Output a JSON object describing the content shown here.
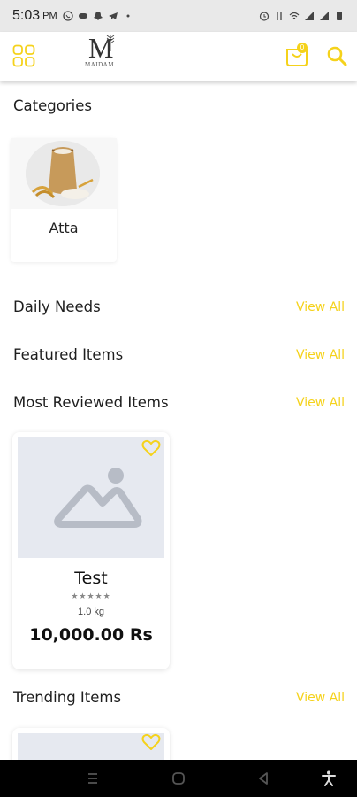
{
  "status_bar": {
    "time": "5:03",
    "ampm": "PM"
  },
  "header": {
    "logo_letter": "M",
    "logo_text": "MAIDAM",
    "cart_count": "0",
    "icons": [
      "grid-menu-icon",
      "cart-icon",
      "search-icon"
    ]
  },
  "sections": {
    "categories": "Categories",
    "daily_needs": "Daily Needs",
    "featured": "Featured Items",
    "most_reviewed": "Most Reviewed Items",
    "trending": "Trending Items",
    "view_all": "View All"
  },
  "categories": [
    {
      "label": "Atta"
    }
  ],
  "products": [
    {
      "name": "Test",
      "stars": "★★★★★",
      "weight": "1.0 kg",
      "price": "10,000.00 Rs"
    }
  ],
  "colors": {
    "accent": "#f5d21b",
    "placeholder_bg": "#e6e9f0",
    "placeholder_fg": "#b7bcc6"
  }
}
